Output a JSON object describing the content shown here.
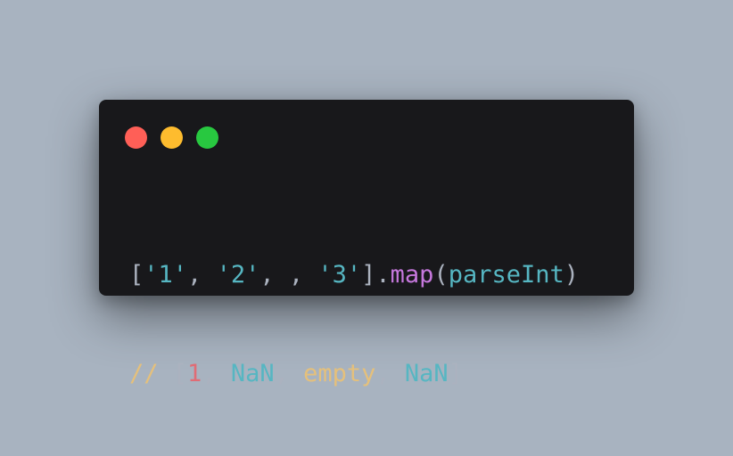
{
  "window": {
    "controls": [
      "close",
      "minimize",
      "maximize"
    ],
    "colors": {
      "background": "#a8b3c0",
      "panel": "#18181b",
      "close": "#ff5f57",
      "minimize": "#febc2e",
      "maximize": "#28c840"
    }
  },
  "code": {
    "line1": {
      "open_bracket": "[",
      "str1": "'1'",
      "comma1": ", ",
      "str2": "'2'",
      "comma2": ", , ",
      "str3": "'3'",
      "close_bracket_dot": "].",
      "method": "map",
      "paren_open": "(",
      "arg": "parseInt",
      "paren_close": ")"
    },
    "line2": {
      "comment": "// ",
      "open_bracket": "[",
      "num1": "1",
      "comma1": ", ",
      "nan1": "NaN",
      "comma2": ", ",
      "empty": "empty",
      "comma3": ", ",
      "nan2": "NaN",
      "close_bracket": "]"
    }
  }
}
